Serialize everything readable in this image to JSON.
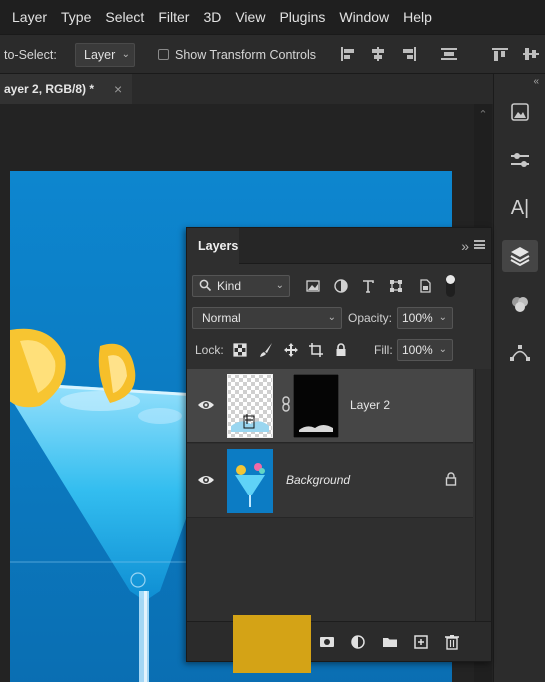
{
  "menubar": {
    "items": [
      "Layer",
      "Type",
      "Select",
      "Filter",
      "3D",
      "View",
      "Plugins",
      "Window",
      "Help"
    ]
  },
  "options_bar": {
    "auto_select_label": "to-Select:",
    "auto_select_value": "Layer",
    "show_transform_label": "Show Transform Controls",
    "show_transform_checked": false
  },
  "document_tab": {
    "title": "ayer 2, RGB/8) *",
    "close_glyph": "×"
  },
  "dock": {
    "tools": [
      "libraries-icon",
      "adjustments-icon",
      "character-icon",
      "layers-icon",
      "channels-icon",
      "paths-icon"
    ],
    "active": "layers-icon",
    "character_glyph": "A|"
  },
  "layers_panel": {
    "title": "Layers",
    "filter": {
      "kind_label": "Kind"
    },
    "blend_mode": "Normal",
    "opacity_label": "Opacity:",
    "opacity_value": "100%",
    "lock_label": "Lock:",
    "fill_label": "Fill:",
    "fill_value": "100%",
    "layers": [
      {
        "name": "Layer 2",
        "visible": true,
        "selected": true,
        "has_mask": true
      },
      {
        "name": "Background",
        "visible": true,
        "locked": true,
        "selected": false
      }
    ]
  },
  "colors": {
    "photo_blue": "#0b7fc7",
    "overlay_yellow": "#d4a316",
    "selected_row": "#464646"
  }
}
